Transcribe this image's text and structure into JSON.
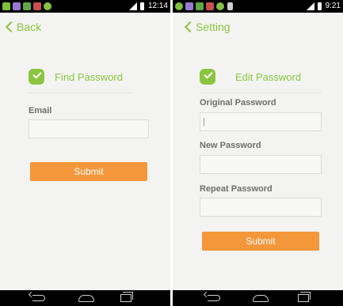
{
  "colors": {
    "accent_green": "#8bc53f",
    "button_orange": "#f4973a",
    "screen_bg": "#f3f3f1",
    "status_bar": "#000000"
  },
  "left_screen": {
    "status_time": "12:14",
    "back_label": "Back",
    "section_title": "Find Password",
    "email_label": "Email",
    "email_value": "",
    "submit_label": "Submit"
  },
  "right_screen": {
    "status_time": "9:21",
    "back_label": "Setting",
    "section_title": "Edit Password",
    "original_password_label": "Original Password",
    "original_password_value": "",
    "new_password_label": "New Password",
    "new_password_value": "",
    "repeat_password_label": "Repeat Password",
    "repeat_password_value": "",
    "submit_label": "Submit"
  },
  "icons": {
    "back": "chevron-left-icon",
    "check": "check-badge-icon",
    "nav_back": "nav-back-icon",
    "nav_home": "nav-home-icon",
    "nav_recents": "nav-recents-icon"
  }
}
